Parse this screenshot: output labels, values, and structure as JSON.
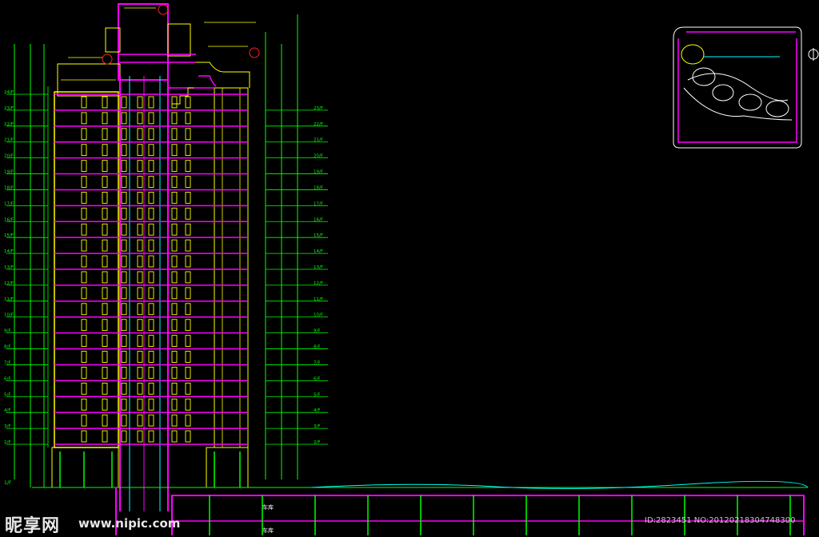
{
  "floors": {
    "left_labels": [
      "24/F",
      "23/F",
      "22/F",
      "21/F",
      "20/F",
      "19/F",
      "18/F",
      "17/F",
      "16/F",
      "15/F",
      "14/F",
      "13/F",
      "12/F",
      "11/F",
      "10/F",
      "9/F",
      "8/F",
      "7/F",
      "6/F",
      "5/F",
      "4/F",
      "3/F",
      "2/F"
    ],
    "right_labels": [
      "23/F",
      "22/F",
      "21/F",
      "20/F",
      "19/F",
      "18/F",
      "17/F",
      "16/F",
      "15/F",
      "14/F",
      "13/F",
      "12/F",
      "11/F",
      "10/F",
      "9/F",
      "8/F",
      "7/F",
      "6/F",
      "5/F",
      "4/F",
      "3/F",
      "2/F"
    ],
    "ground_label": "1/F"
  },
  "garage": {
    "label_1": "车库",
    "label_2": "车库"
  },
  "watermark": {
    "brand": "昵享网",
    "url": "www.nipic.com",
    "id_text": "ID:2823451 NO:20120218304748300"
  },
  "colors": {
    "background": "#000000",
    "magenta": "#ff00ff",
    "yellow": "#ffff00",
    "green": "#00ff00",
    "cyan": "#00ffff",
    "white": "#ffffff",
    "red": "#ff2020",
    "blue": "#5a5aff"
  },
  "icons": {
    "site_plan": "site-plan-inset-icon",
    "section_marker": "section-marker-icon"
  }
}
